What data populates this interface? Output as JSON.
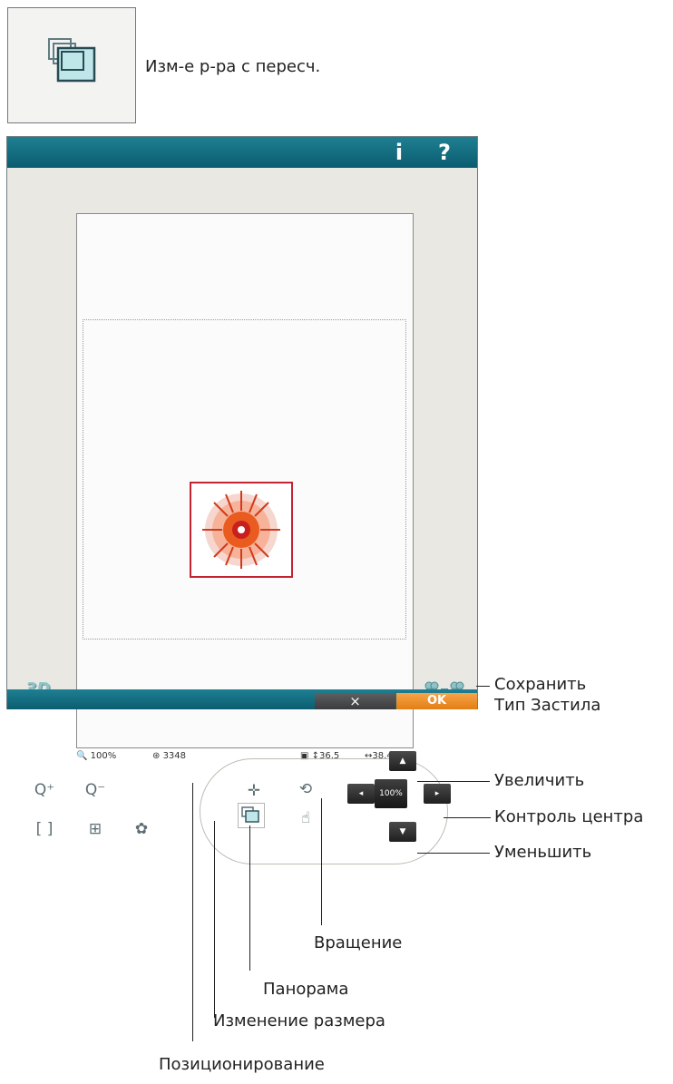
{
  "header_icon": {
    "name": "resize-recalc-icon",
    "caption": "Изм-е р-ра с пересч."
  },
  "window": {
    "info_button": "i",
    "help_button": "?"
  },
  "canvas": {
    "btn_3d": "3D"
  },
  "status": {
    "zoom": "100%",
    "stitches": "3348",
    "height": "↕36.5",
    "width": "↔38.4"
  },
  "control": {
    "center_value": "100%"
  },
  "buttons": {
    "cancel": "×",
    "ok": "OK"
  },
  "callouts": {
    "save_stitch_type_1": "Сохранить",
    "save_stitch_type_2": "Тип Застила",
    "increase": "Увеличить",
    "center_control": "Контроль центра",
    "decrease": "Уменьшить",
    "rotate": "Вращение",
    "pan": "Панорама",
    "resize": "Изменение размера",
    "position": "Позиционирование"
  },
  "colors": {
    "title_bar": "#0b5d70",
    "ok_button": "#e37e13",
    "design_frame": "#c22530",
    "accent_icon": "#8fc3c7"
  }
}
